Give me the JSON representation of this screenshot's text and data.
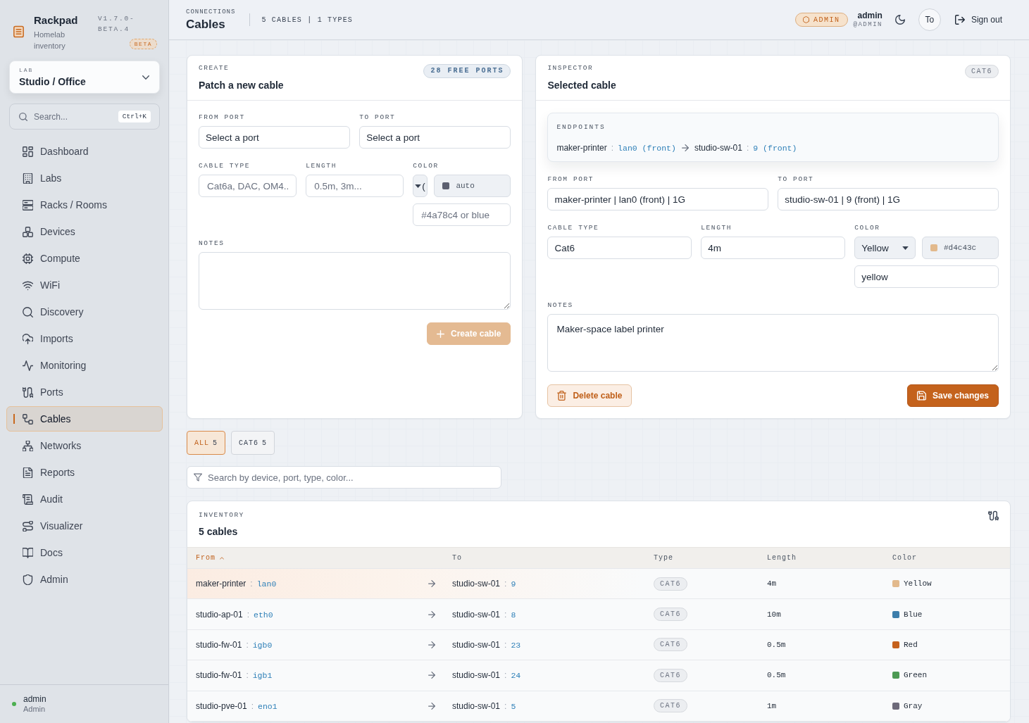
{
  "sidebar": {
    "brand": {
      "name": "Rackpad",
      "tagline": "Homelab inventory",
      "version": "V1.7.0-BETA.4",
      "badge": "BETA"
    },
    "lab_picker": {
      "label": "LAB",
      "value": "Studio / Office"
    },
    "search": {
      "placeholder": "Search...",
      "shortcut": "Ctrl+K"
    },
    "items": [
      {
        "label": "Dashboard",
        "selected": false
      },
      {
        "label": "Labs",
        "selected": false
      },
      {
        "label": "Racks / Rooms",
        "selected": false
      },
      {
        "label": "Devices",
        "selected": false
      },
      {
        "label": "Compute",
        "selected": false
      },
      {
        "label": "WiFi",
        "selected": false
      },
      {
        "label": "Discovery",
        "selected": false
      },
      {
        "label": "Imports",
        "selected": false
      },
      {
        "label": "Monitoring",
        "selected": false
      },
      {
        "label": "Ports",
        "selected": false
      },
      {
        "label": "Cables",
        "selected": true
      },
      {
        "label": "Networks",
        "selected": false
      },
      {
        "label": "Reports",
        "selected": false
      },
      {
        "label": "Audit",
        "selected": false
      },
      {
        "label": "Visualizer",
        "selected": false
      },
      {
        "label": "Docs",
        "selected": false
      },
      {
        "label": "Admin",
        "selected": false
      }
    ],
    "user": {
      "name": "admin",
      "role": "Admin",
      "online": true
    }
  },
  "header": {
    "section": "CONNECTIONS",
    "title": "Cables",
    "stats": "5 CABLES | 1 TYPES",
    "role_badge": "ADMIN",
    "user": {
      "name": "admin",
      "handle": "@ADMIN"
    },
    "avatar": "To",
    "sign_out": "Sign out"
  },
  "create": {
    "eyebrow": "CREATE",
    "title": "Patch a new cable",
    "badge": "28 FREE PORTS",
    "from_port": {
      "label": "FROM PORT",
      "value": "Select a port"
    },
    "to_port": {
      "label": "TO PORT",
      "value": "Select a port"
    },
    "cable_type": {
      "label": "CABLE TYPE",
      "placeholder": "Cat6a, DAC, OM4..."
    },
    "length": {
      "label": "LENGTH",
      "placeholder": "0.5m, 3m..."
    },
    "color": {
      "label": "COLOR",
      "select_value": "(",
      "value": "auto",
      "placeholder": "#4a78c4 or blue"
    },
    "notes": {
      "label": "NOTES"
    },
    "button": {
      "label": "Create cable",
      "disabled": true
    }
  },
  "inspector": {
    "eyebrow": "INSPECTOR",
    "title": "Selected cable",
    "badge": "CAT6",
    "endpoints": {
      "label": "ENDPOINTS",
      "from": {
        "device": "maker-printer",
        "separator": ":",
        "port": "lan0 (front)"
      },
      "to": {
        "device": "studio-sw-01",
        "separator": ":",
        "port": "9 (front)"
      }
    },
    "from_port": {
      "label": "FROM PORT",
      "value": "maker-printer | lan0 (front) | 1G"
    },
    "to_port": {
      "label": "TO PORT",
      "value": "studio-sw-01 | 9 (front) | 1G"
    },
    "cable_type": {
      "label": "CABLE TYPE",
      "value": "Cat6"
    },
    "length": {
      "label": "LENGTH",
      "value": "4m"
    },
    "color": {
      "label": "COLOR",
      "select_value": "Yellow",
      "hex": "#d4c43c",
      "color": "#e2b98c",
      "value": "yellow"
    },
    "notes": {
      "label": "NOTES",
      "value": "Maker-space label printer"
    },
    "delete_button": "Delete cable",
    "save_button": "Save changes"
  },
  "filters": [
    {
      "label": "ALL",
      "count": "5",
      "selected": true
    },
    {
      "label": "CAT6",
      "count": "5",
      "selected": false
    }
  ],
  "table_search": {
    "placeholder": "Search by device, port, type, color..."
  },
  "inventory": {
    "eyebrow": "INVENTORY",
    "title": "5 cables",
    "columns": [
      {
        "label": "From",
        "sorted": true
      },
      {
        "label": "To",
        "sorted": false
      },
      {
        "label": "Type",
        "sorted": false
      },
      {
        "label": "Length",
        "sorted": false
      },
      {
        "label": "Color",
        "sorted": false
      }
    ],
    "rows": [
      {
        "from": {
          "device": "maker-printer",
          "separator": ":",
          "port": "lan0"
        },
        "to": {
          "device": "studio-sw-01",
          "separator": ":",
          "port": "9"
        },
        "type": "CAT6",
        "length": "4m",
        "color_name": "Yellow",
        "color": "#e2b98c",
        "selected": true
      },
      {
        "from": {
          "device": "studio-ap-01",
          "separator": ":",
          "port": "eth0"
        },
        "to": {
          "device": "studio-sw-01",
          "separator": ":",
          "port": "8"
        },
        "type": "CAT6",
        "length": "10m",
        "color_name": "Blue",
        "color": "#3d7eab",
        "selected": false
      },
      {
        "from": {
          "device": "studio-fw-01",
          "separator": ":",
          "port": "igb0"
        },
        "to": {
          "device": "studio-sw-01",
          "separator": ":",
          "port": "23"
        },
        "type": "CAT6",
        "length": "0.5m",
        "color_name": "Red",
        "color": "#c5611c",
        "selected": false
      },
      {
        "from": {
          "device": "studio-fw-01",
          "separator": ":",
          "port": "igb1"
        },
        "to": {
          "device": "studio-sw-01",
          "separator": ":",
          "port": "24"
        },
        "type": "CAT6",
        "length": "0.5m",
        "color_name": "Green",
        "color": "#4d9a53",
        "selected": false
      },
      {
        "from": {
          "device": "studio-pve-01",
          "separator": ":",
          "port": "eno1"
        },
        "to": {
          "device": "studio-sw-01",
          "separator": ":",
          "port": "5"
        },
        "type": "CAT6",
        "length": "1m",
        "color_name": "Gray",
        "color": "#6e6a7a",
        "selected": false
      }
    ]
  }
}
